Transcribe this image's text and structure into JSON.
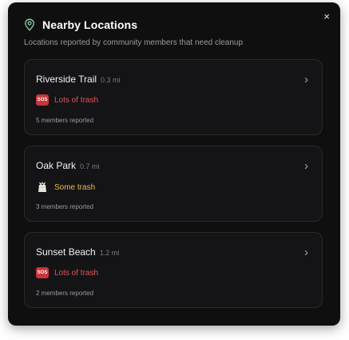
{
  "header": {
    "title": "Nearby Locations",
    "subtitle": "Locations reported by community members that need cleanup",
    "close_label": "×"
  },
  "locations": [
    {
      "name": "Riverside Trail",
      "distance": "0.3 mi",
      "level": "Lots of trash",
      "level_icon": "sos-icon",
      "icon_text": "SOS",
      "reported": "5 members reported"
    },
    {
      "name": "Oak Park",
      "distance": "0.7 mi",
      "level": "Some trash",
      "level_icon": "trash-bag-icon",
      "reported": "3 members reported"
    },
    {
      "name": "Sunset Beach",
      "distance": "1.2 mi",
      "level": "Lots of trash",
      "level_icon": "sos-icon",
      "icon_text": "SOS",
      "reported": "2 members reported"
    }
  ],
  "colors": {
    "panel_bg": "#0f0f10",
    "card_bg": "#141416",
    "lots_of_trash": "#e0555b",
    "some_trash": "#e9b949",
    "sos_badge": "#c8343a",
    "pin_icon": "#8fd3a4"
  }
}
